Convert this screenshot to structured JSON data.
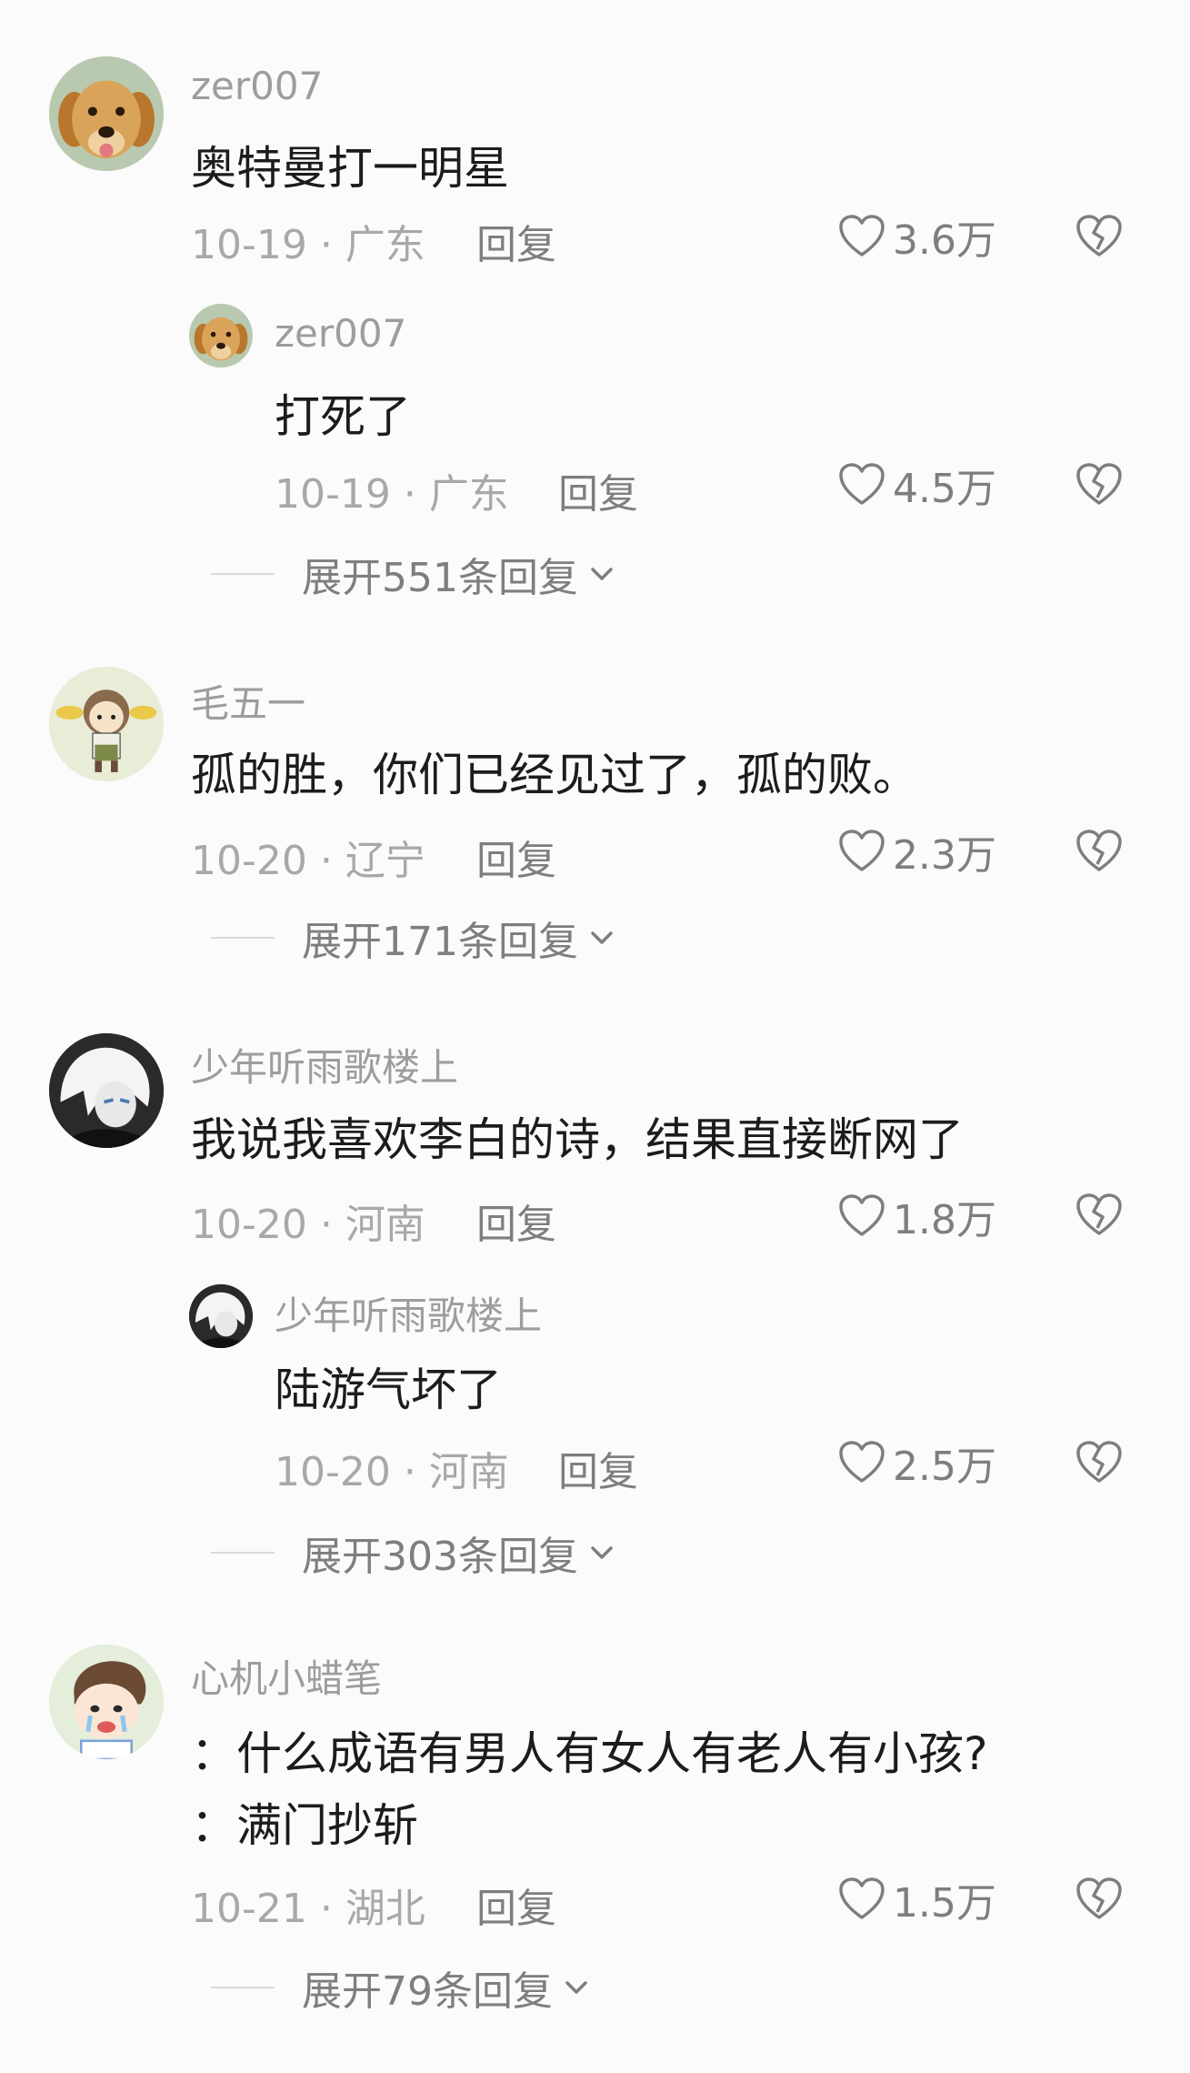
{
  "comments": [
    {
      "username": "zer007",
      "text": "奥特曼打一明星",
      "meta": "10-19 · 广东",
      "reply": "回复",
      "likes": "3.6万",
      "avatar_icon": "golden-retriever-avatar",
      "subreply": {
        "username": "zer007",
        "text": "打死了",
        "meta": "10-19 · 广东",
        "reply": "回复",
        "likes": "4.5万"
      },
      "expand": "展开551条回复"
    },
    {
      "username": "毛五一",
      "text": "孤的胜，你们已经见过了，孤的败。",
      "meta": "10-20 · 辽宁",
      "reply": "回复",
      "likes": "2.3万",
      "avatar_icon": "cartoon-girl-avatar",
      "expand": "展开171条回复"
    },
    {
      "username": "少年听雨歌楼上",
      "text": "我说我喜欢李白的诗，结果直接断网了",
      "meta": "10-20 · 河南",
      "reply": "回复",
      "likes": "1.8万",
      "avatar_icon": "anime-boy-avatar",
      "subreply": {
        "username": "少年听雨歌楼上",
        "text": "陆游气坏了",
        "meta": "10-20 · 河南",
        "reply": "回复",
        "likes": "2.5万"
      },
      "expand": "展开303条回复"
    },
    {
      "username": "心机小蜡笔",
      "text": "：什么成语有男人有女人有老人有小孩?",
      "text2": "：满门抄斩",
      "meta": "10-21 · 湖北",
      "reply": "回复",
      "likes": "1.5万",
      "avatar_icon": "crying-cartoon-boy-avatar",
      "expand": "展开79条回复"
    }
  ]
}
